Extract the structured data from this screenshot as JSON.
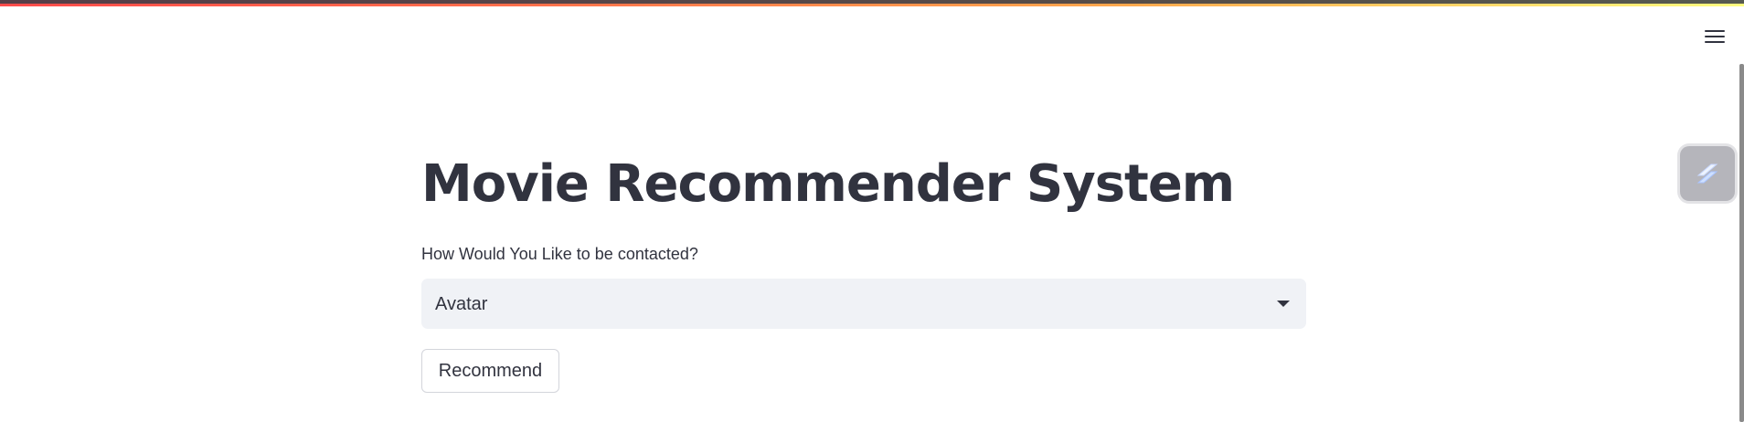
{
  "app": {
    "accent_colors": [
      "#ff4b4b",
      "#ffa94d",
      "#fffd80"
    ],
    "menu_icon": "hamburger-menu-icon",
    "side_widget_icon": "streamlit-logo-icon"
  },
  "main": {
    "title": "Movie Recommender System",
    "select": {
      "label": "How Would You Like to be contacted?",
      "value": "Avatar",
      "caret_icon": "caret-down-icon"
    },
    "recommend_button_label": "Recommend"
  }
}
